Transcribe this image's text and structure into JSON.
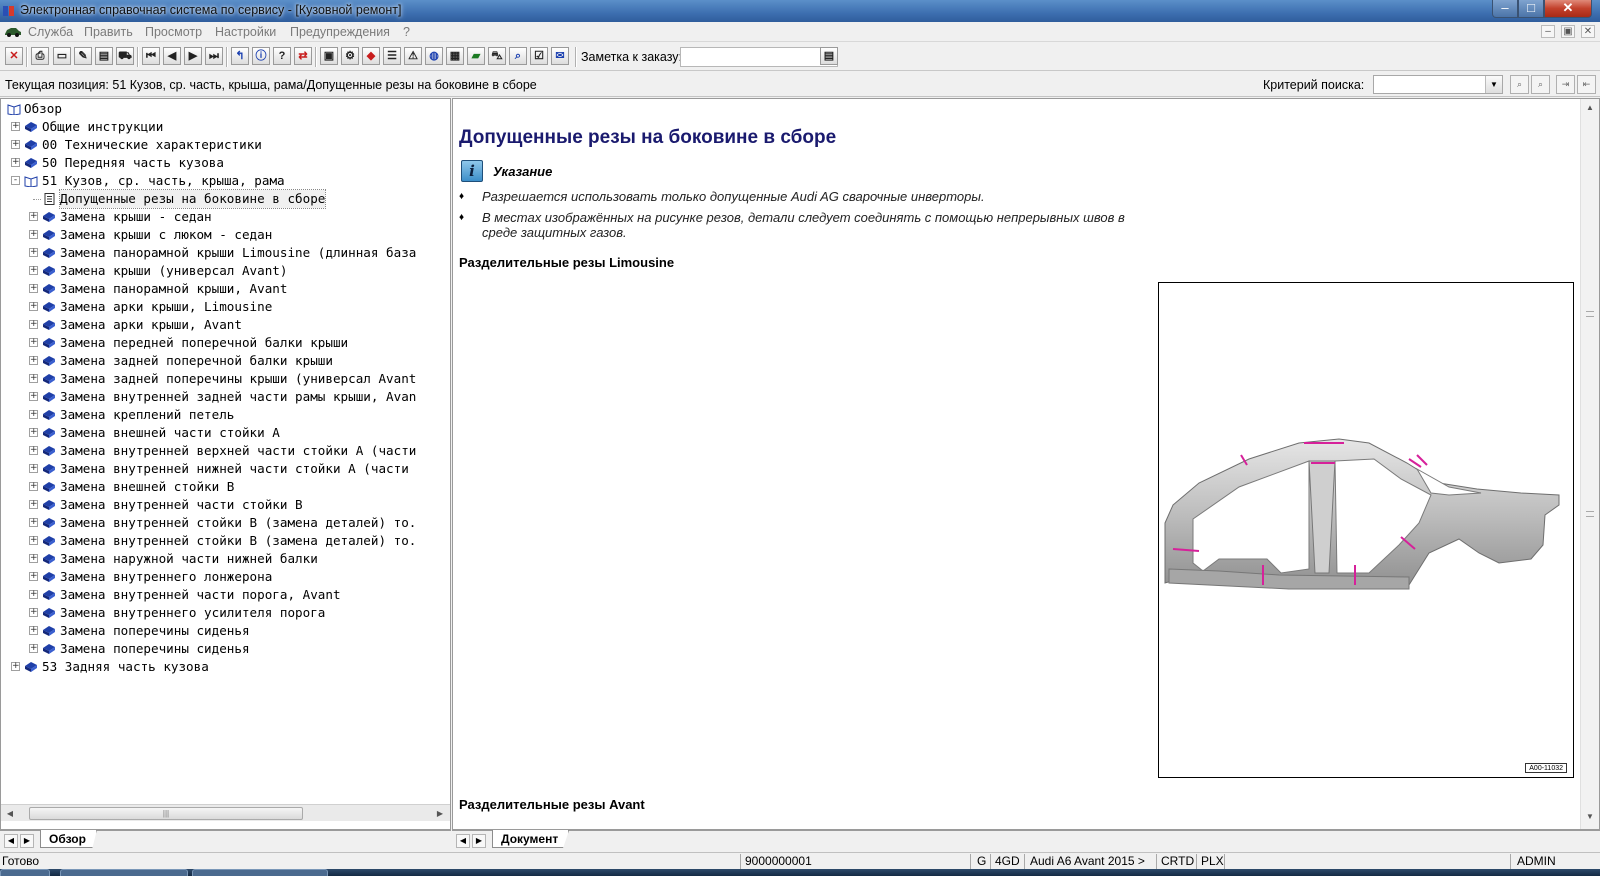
{
  "window": {
    "title": "Электронная справочная система по сервису - [Кузовной ремонт]",
    "min_glyph": "–",
    "max_glyph": "□",
    "close_glyph": "✕"
  },
  "menu": {
    "items": [
      "Служба",
      "Править",
      "Просмотр",
      "Настройки",
      "Предупреждения",
      "?"
    ],
    "mdi_min": "–",
    "mdi_restore": "▣",
    "mdi_close": "✕"
  },
  "toolbar": {
    "order_label": "Заметка к заказу:",
    "order_value": ""
  },
  "position": {
    "text": "Текущая позиция: 51 Кузов, ср. часть, крыша, рама/Допущенные резы на боковине в сборе",
    "search_label": "Критерий поиска:",
    "search_value": ""
  },
  "tree": {
    "root": "Обзор",
    "items": [
      {
        "label": "Общие инструкции",
        "level": 1,
        "exp": "+"
      },
      {
        "label": "00 Технические характеристики",
        "level": 1,
        "exp": "+"
      },
      {
        "label": "50 Передняя часть кузова",
        "level": 1,
        "exp": "+"
      },
      {
        "label": "51 Кузов, ср. часть, крыша, рама",
        "level": 1,
        "exp": "-",
        "open": true
      },
      {
        "label": "Допущенные резы на боковине в сборе",
        "level": 2,
        "doc": true,
        "selected": true
      },
      {
        "label": "Замена крыши - седан",
        "level": 2,
        "exp": "+"
      },
      {
        "label": "Замена крыши с люком - седан",
        "level": 2,
        "exp": "+"
      },
      {
        "label": "Замена панорамной крыши Limousine (длинная база",
        "level": 2,
        "exp": "+"
      },
      {
        "label": "Замена крыши (универсал Avant)",
        "level": 2,
        "exp": "+"
      },
      {
        "label": "Замена панорамной крыши, Avant",
        "level": 2,
        "exp": "+"
      },
      {
        "label": "Замена арки крыши, Limousine",
        "level": 2,
        "exp": "+"
      },
      {
        "label": "Замена арки крыши, Avant",
        "level": 2,
        "exp": "+"
      },
      {
        "label": "Замена передней поперечной балки крыши",
        "level": 2,
        "exp": "+"
      },
      {
        "label": "Замена задней поперечной балки крыши",
        "level": 2,
        "exp": "+"
      },
      {
        "label": "Замена задней поперечины крыши (универсал Avant",
        "level": 2,
        "exp": "+"
      },
      {
        "label": "Замена внутренней задней части рамы крыши, Avan",
        "level": 2,
        "exp": "+"
      },
      {
        "label": "Замена креплений петель",
        "level": 2,
        "exp": "+"
      },
      {
        "label": "Замена внешней части стойки А",
        "level": 2,
        "exp": "+"
      },
      {
        "label": "Замена внутренней верхней части стойки А (части",
        "level": 2,
        "exp": "+"
      },
      {
        "label": "Замена внутренней нижней части стойки А (части",
        "level": 2,
        "exp": "+"
      },
      {
        "label": "Замена внешней стойки В",
        "level": 2,
        "exp": "+"
      },
      {
        "label": "Замена внутренней части стойки В",
        "level": 2,
        "exp": "+"
      },
      {
        "label": "Замена внутренней стойки В (замена деталей) то.",
        "level": 2,
        "exp": "+"
      },
      {
        "label": "Замена внутренней стойки В (замена деталей) то.",
        "level": 2,
        "exp": "+"
      },
      {
        "label": "Замена наружной части нижней балки",
        "level": 2,
        "exp": "+"
      },
      {
        "label": "Замена внутреннего лонжерона",
        "level": 2,
        "exp": "+"
      },
      {
        "label": "Замена внутренней части порога, Avant",
        "level": 2,
        "exp": "+"
      },
      {
        "label": "Замена внутреннего усилителя порога",
        "level": 2,
        "exp": "+"
      },
      {
        "label": "Замена поперечины сиденья",
        "level": 2,
        "exp": "+"
      },
      {
        "label": "Замена поперечины сиденья",
        "level": 2,
        "exp": "+"
      },
      {
        "label": "53 Задняя часть кузова",
        "level": 1,
        "exp": "+"
      }
    ],
    "tab_label": "Обзор"
  },
  "document": {
    "title": "Допущенные резы на боковине в сборе",
    "notice_label": "Указание",
    "notice_icon": "i",
    "bullet_glyph": "♦",
    "bullets": [
      "Разрешается использовать только допущенные Audi AG сварочные инверторы.",
      "В местах изображённых на рисунке резов, детали следует соединять с помощью непрерывных швов в среде защитных газов."
    ],
    "section1": "Разделительные резы Limousine",
    "figure_code": "A00-11032",
    "section2": "Разделительные резы Avant",
    "tab_label": "Документ"
  },
  "status": {
    "ready": "Готово",
    "number": "9000000001",
    "g": "G",
    "code": "4GD",
    "vehicle": "Audi A6 Avant 2015 >",
    "crtd": "CRTD",
    "plx": "PLX",
    "user": "ADMIN"
  },
  "colors": {
    "title_blue": "#1a1a6e",
    "book_blue": "#1f3fa8",
    "cut_mark": "#d6219a"
  }
}
